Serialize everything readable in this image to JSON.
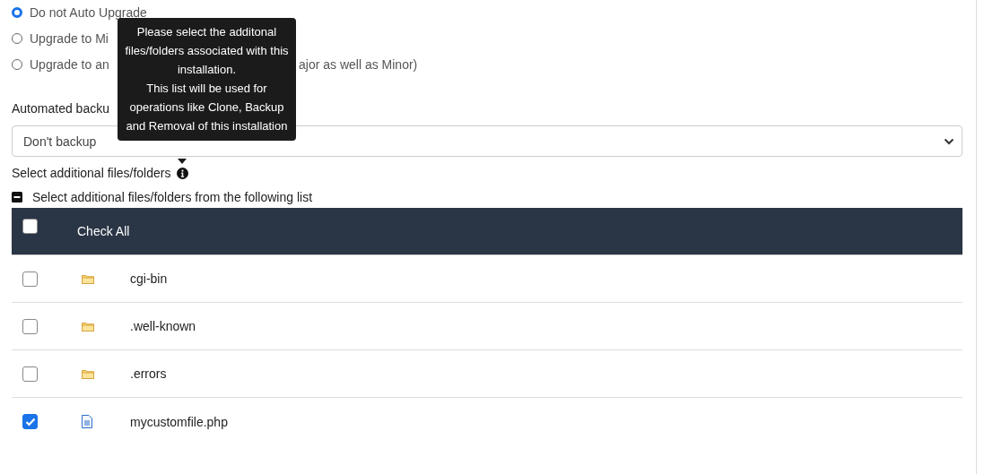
{
  "upgrade_options": [
    {
      "label": "Do not Auto Upgrade",
      "selected": true
    },
    {
      "label": "Upgrade to Mi",
      "selected": false
    },
    {
      "label": "Upgrade to an",
      "label_after": "ajor as well as Minor)",
      "selected": false
    }
  ],
  "backups": {
    "label": "Automated backu",
    "value": "Don't backup"
  },
  "additional": {
    "label": "Select additional files/folders",
    "tooltip_lines": [
      "Please select the additonal files/folders associated with this installation.",
      "This list will be used for operations like Clone, Backup and Removal of this installation"
    ],
    "list_label": "Select additional files/folders from the following list",
    "expanded": true
  },
  "table": {
    "header": {
      "label": "Check All",
      "checked": false
    },
    "rows": [
      {
        "name": "cgi-bin",
        "kind": "folder",
        "checked": false
      },
      {
        "name": ".well-known",
        "kind": "folder",
        "checked": false
      },
      {
        "name": ".errors",
        "kind": "folder",
        "checked": false
      },
      {
        "name": "mycustomfile.php",
        "kind": "file",
        "checked": true
      }
    ]
  }
}
